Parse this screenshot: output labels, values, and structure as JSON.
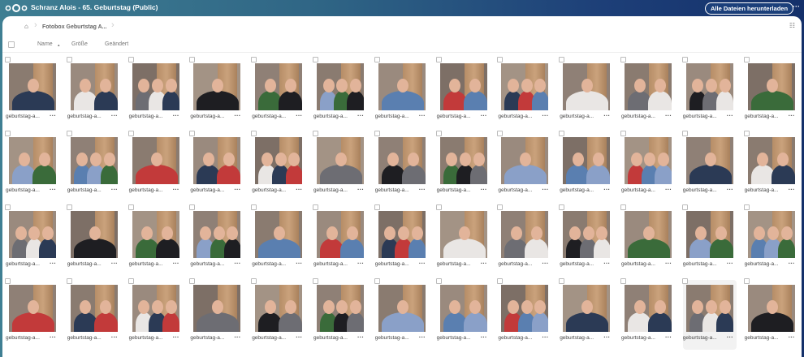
{
  "header": {
    "title": "Schranz Alois - 65. Geburtstag (Public)",
    "download_all": "Alle Dateien herunterladen",
    "more": "···"
  },
  "breadcrumb": {
    "home_icon": "home-icon",
    "folder": "Fotobox Geburtstag A..."
  },
  "columns": {
    "name": "Name",
    "sort_indicator": "▴",
    "size": "Größe",
    "modified": "Geändert"
  },
  "view_toggle_icon": "grid-view-icon",
  "files": {
    "label": "geburtstag-a...",
    "more": "···",
    "count": 52,
    "highlighted_index": 50
  },
  "colors": {
    "header_left": "#3f7f93",
    "header_right": "#14306a",
    "card": "#ffffff"
  }
}
